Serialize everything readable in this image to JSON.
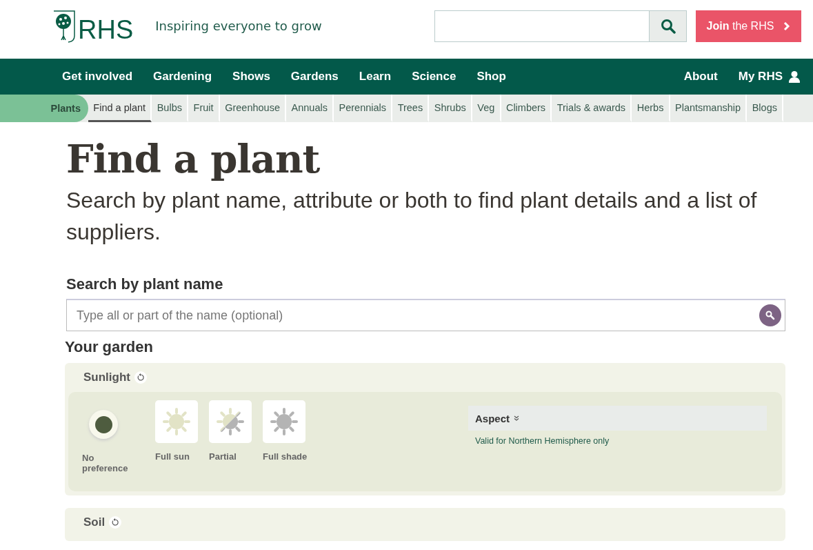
{
  "header": {
    "logo_text": "RHS",
    "tagline": "Inspiring everyone to grow",
    "join_button": "**Join** the RHS"
  },
  "main_nav": {
    "left": [
      "Get involved",
      "Gardening",
      "Shows",
      "Gardens",
      "Learn",
      "Science",
      "Shop"
    ],
    "right": [
      {
        "label": "About",
        "kind": "link"
      },
      {
        "label": "My RHS",
        "kind": "account"
      }
    ]
  },
  "sub_nav": {
    "section": "Plants",
    "items": [
      {
        "label": "Find a plant",
        "selected": true
      },
      {
        "label": "Bulbs",
        "selected": false
      },
      {
        "label": "Fruit",
        "selected": false
      },
      {
        "label": "Greenhouse",
        "selected": false
      },
      {
        "label": "Annuals",
        "selected": false
      },
      {
        "label": "Perennials",
        "selected": false
      },
      {
        "label": "Trees",
        "selected": false
      },
      {
        "label": "Shrubs",
        "selected": false
      },
      {
        "label": "Veg",
        "selected": false
      },
      {
        "label": "Climbers",
        "selected": false
      },
      {
        "label": "Trials & awards",
        "selected": false
      },
      {
        "label": "Herbs",
        "selected": false
      },
      {
        "label": "Plantsmanship",
        "selected": false
      },
      {
        "label": "Blogs",
        "selected": false
      }
    ]
  },
  "page": {
    "title": "Find a plant",
    "intro": "Search by plant name, attribute or both to find plant details and a list of suppliers."
  },
  "name_search": {
    "heading": "Search by plant name",
    "placeholder": "Type all or part of the name (optional)"
  },
  "garden": {
    "heading": "Your garden",
    "sunlight": {
      "heading": "Sunlight",
      "options": [
        {
          "label": "No preference",
          "kind": "none",
          "selected": true
        },
        {
          "label": "Full sun",
          "kind": "sun",
          "selected": false
        },
        {
          "label": "Partial",
          "kind": "partial",
          "selected": false
        },
        {
          "label": "Full shade",
          "kind": "shade",
          "selected": false
        }
      ],
      "aspect": {
        "label": "Aspect",
        "expanded": false,
        "note": "Valid for Northern Hemisphere only"
      }
    },
    "soil": {
      "heading": "Soil"
    }
  }
}
